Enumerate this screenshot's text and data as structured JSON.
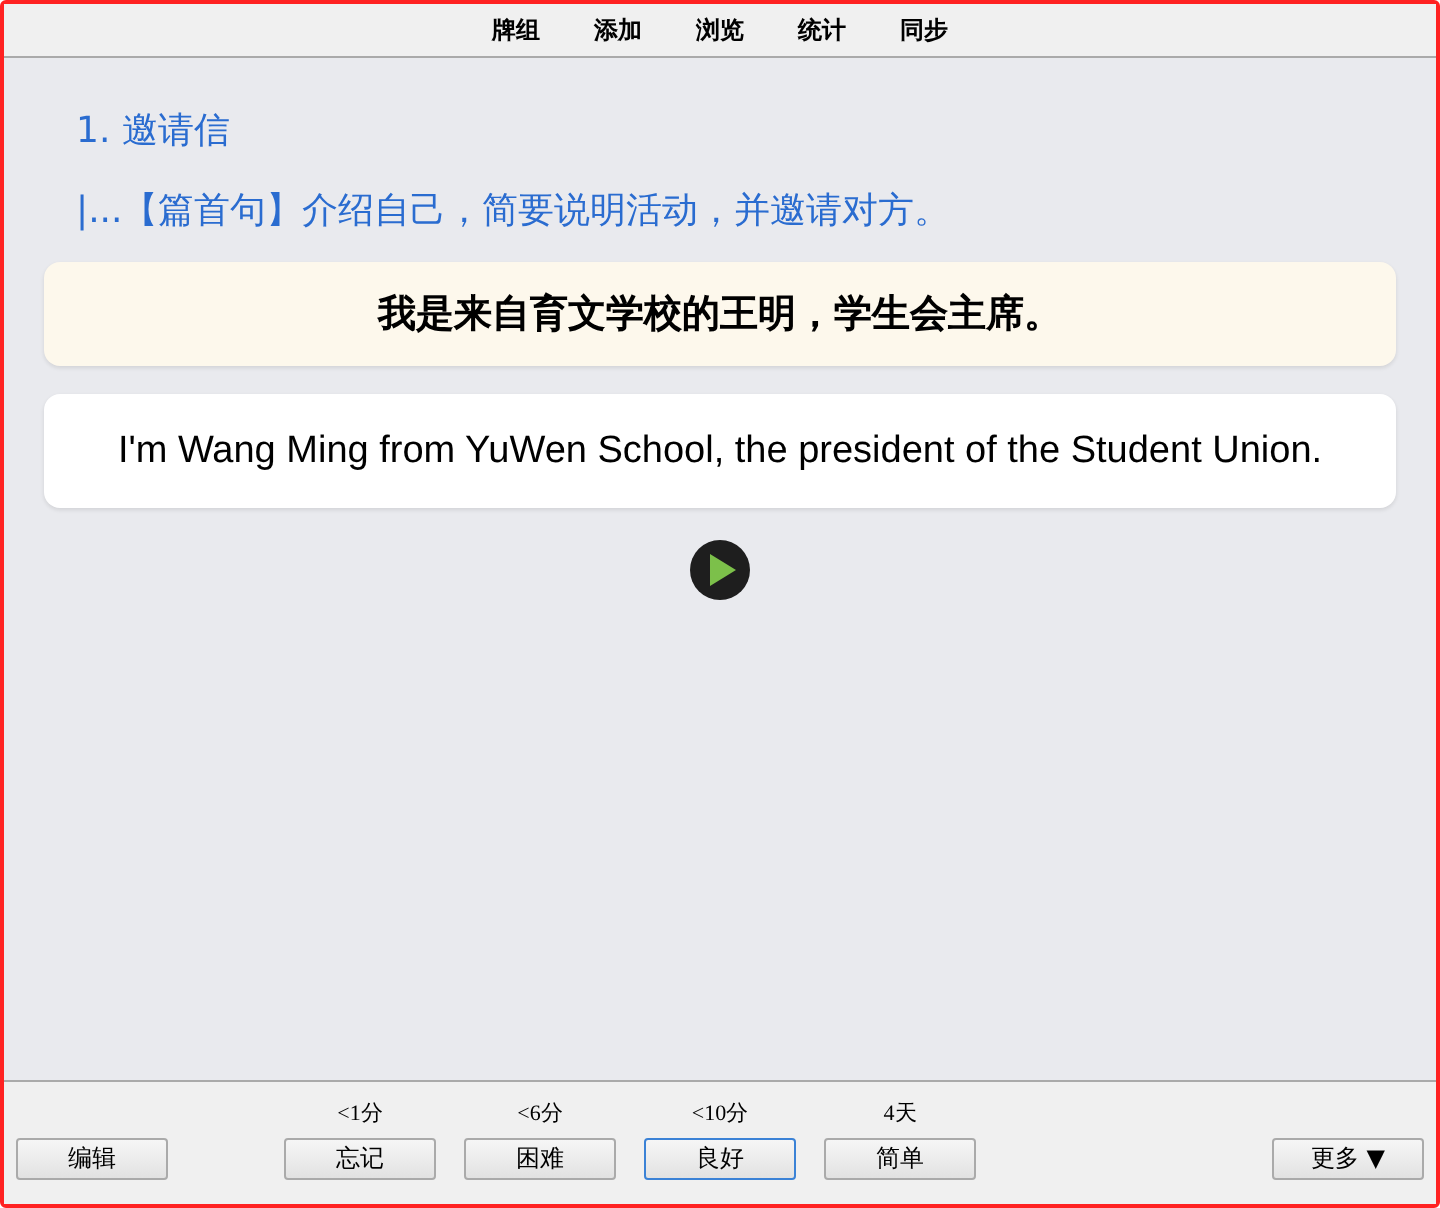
{
  "menu": [
    {
      "label": "牌组"
    },
    {
      "label": "添加"
    },
    {
      "label": "浏览"
    },
    {
      "label": "统计"
    },
    {
      "label": "同步"
    }
  ],
  "card": {
    "title": "1. 邀请信",
    "subtitle": "|...【篇首句】介绍自己，简要说明活动，并邀请对方。",
    "question": "我是来自育文学校的王明，学生会主席。",
    "answer": "I'm Wang Ming from YuWen School, the president of the Student Union."
  },
  "bottom": {
    "edit": "编辑",
    "more": "更多 ▼",
    "answers": [
      {
        "time": "<1分",
        "label": "忘记",
        "selected": false
      },
      {
        "time": "<6分",
        "label": "困难",
        "selected": false
      },
      {
        "time": "<10分",
        "label": "良好",
        "selected": true
      },
      {
        "time": "4天",
        "label": "简单",
        "selected": false
      }
    ]
  }
}
